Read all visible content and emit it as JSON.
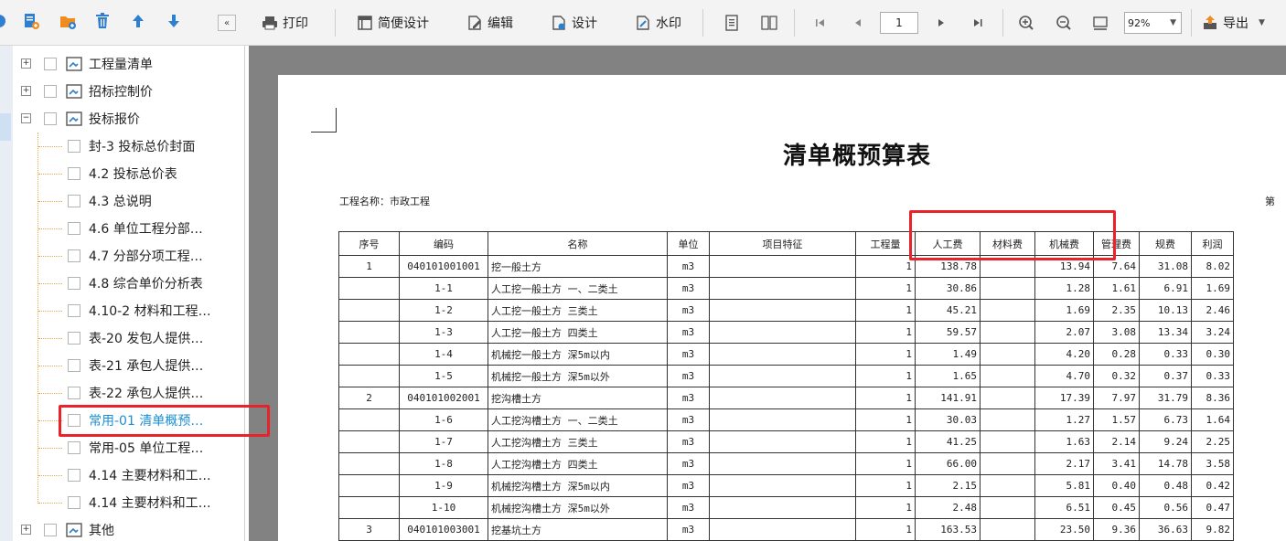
{
  "toolbar": {
    "print": "打印",
    "simple_design": "简便设计",
    "edit": "编辑",
    "design": "设计",
    "watermark": "水印",
    "page_number": "1",
    "zoom": "92%",
    "export": "导出"
  },
  "tree": {
    "items": [
      {
        "label": "工程量清单"
      },
      {
        "label": "招标控制价"
      },
      {
        "label": "投标报价"
      },
      {
        "label": "封-3 投标总价封面"
      },
      {
        "label": "4.2 投标总价表"
      },
      {
        "label": "4.3 总说明"
      },
      {
        "label": "4.6 单位工程分部…"
      },
      {
        "label": "4.7 分部分项工程…"
      },
      {
        "label": "4.8 综合单价分析表"
      },
      {
        "label": "4.10-2 材料和工程…"
      },
      {
        "label": "表-20 发包人提供…"
      },
      {
        "label": "表-21 承包人提供…"
      },
      {
        "label": "表-22 承包人提供…"
      },
      {
        "label": "常用-01 清单概预…"
      },
      {
        "label": "常用-05 单位工程…"
      },
      {
        "label": "4.14 主要材料和工…"
      },
      {
        "label": "4.14 主要材料和工…"
      },
      {
        "label": "其他"
      }
    ],
    "selected_index": 13
  },
  "report": {
    "title": "清单概预算表",
    "project_name": "工程名称：市政工程",
    "page_label": "第",
    "columns": [
      "序号",
      "编码",
      "名称",
      "单位",
      "项目特征",
      "工程量",
      "人工费",
      "材料费",
      "机械费",
      "管理费",
      "规费",
      "利润"
    ],
    "rows": [
      [
        "1",
        "040101001001",
        "挖一般土方",
        "m3",
        "",
        "1",
        "138.78",
        "",
        "13.94",
        "7.64",
        "31.08",
        "8.02"
      ],
      [
        "",
        "1-1",
        "人工挖一般土方 一、二类土",
        "m3",
        "",
        "1",
        "30.86",
        "",
        "1.28",
        "1.61",
        "6.91",
        "1.69"
      ],
      [
        "",
        "1-2",
        "人工挖一般土方 三类土",
        "m3",
        "",
        "1",
        "45.21",
        "",
        "1.69",
        "2.35",
        "10.13",
        "2.46"
      ],
      [
        "",
        "1-3",
        "人工挖一般土方 四类土",
        "m3",
        "",
        "1",
        "59.57",
        "",
        "2.07",
        "3.08",
        "13.34",
        "3.24"
      ],
      [
        "",
        "1-4",
        "机械挖一般土方 深5m以内",
        "m3",
        "",
        "1",
        "1.49",
        "",
        "4.20",
        "0.28",
        "0.33",
        "0.30"
      ],
      [
        "",
        "1-5",
        "机械挖一般土方 深5m以外",
        "m3",
        "",
        "1",
        "1.65",
        "",
        "4.70",
        "0.32",
        "0.37",
        "0.33"
      ],
      [
        "2",
        "040101002001",
        "挖沟槽土方",
        "m3",
        "",
        "1",
        "141.91",
        "",
        "17.39",
        "7.97",
        "31.79",
        "8.36"
      ],
      [
        "",
        "1-6",
        "人工挖沟槽土方 一、二类土",
        "m3",
        "",
        "1",
        "30.03",
        "",
        "1.27",
        "1.57",
        "6.73",
        "1.64"
      ],
      [
        "",
        "1-7",
        "人工挖沟槽土方 三类土",
        "m3",
        "",
        "1",
        "41.25",
        "",
        "1.63",
        "2.14",
        "9.24",
        "2.25"
      ],
      [
        "",
        "1-8",
        "人工挖沟槽土方 四类土",
        "m3",
        "",
        "1",
        "66.00",
        "",
        "2.17",
        "3.41",
        "14.78",
        "3.58"
      ],
      [
        "",
        "1-9",
        "机械挖沟槽土方 深5m以内",
        "m3",
        "",
        "1",
        "2.15",
        "",
        "5.81",
        "0.40",
        "0.48",
        "0.42"
      ],
      [
        "",
        "1-10",
        "机械挖沟槽土方 深5m以外",
        "m3",
        "",
        "1",
        "2.48",
        "",
        "6.51",
        "0.45",
        "0.56",
        "0.47"
      ],
      [
        "3",
        "040101003001",
        "挖基坑土方",
        "m3",
        "",
        "1",
        "163.53",
        "",
        "23.50",
        "9.36",
        "36.63",
        "9.82"
      ]
    ]
  },
  "colors": {
    "highlight": "#e8242a",
    "selected_text": "#1a8fd6",
    "tree_lines": "#e8a64b",
    "toolbar_blue": "#2f7fd1",
    "toolbar_orange": "#f08c1e"
  }
}
